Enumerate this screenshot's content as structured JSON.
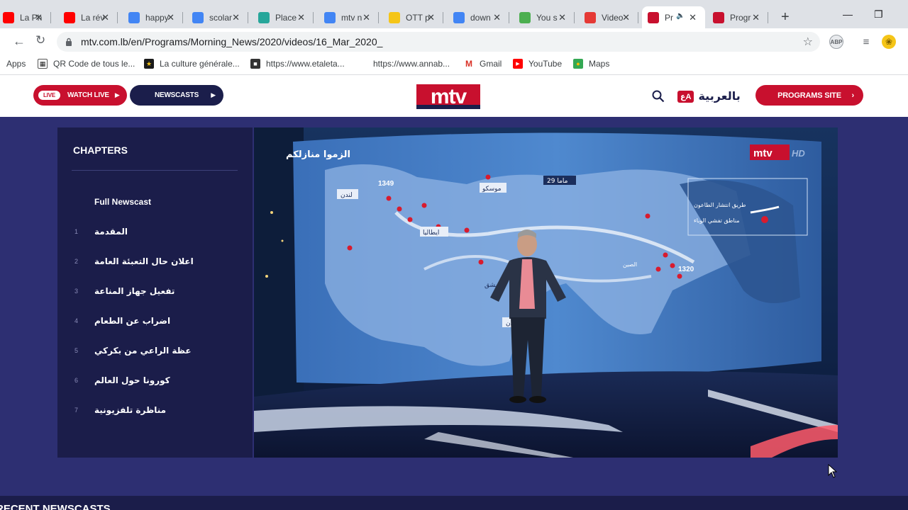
{
  "browser": {
    "tabs": [
      {
        "title": "La Ph",
        "favicon": "youtube-icon",
        "color": "#ff0000"
      },
      {
        "title": "La rév",
        "favicon": "youtube-icon",
        "color": "#ff0000"
      },
      {
        "title": "happy",
        "favicon": "google-icon",
        "color": "#4285f4"
      },
      {
        "title": "scolar",
        "favicon": "google-icon",
        "color": "#4285f4"
      },
      {
        "title": "Place",
        "favicon": "globe-icon",
        "color": "#26a69a"
      },
      {
        "title": "mtv n",
        "favicon": "google-icon",
        "color": "#4285f4"
      },
      {
        "title": "OTT p",
        "favicon": "ott-icon",
        "color": "#f5c518"
      },
      {
        "title": "down",
        "favicon": "google-icon",
        "color": "#4285f4"
      },
      {
        "title": "You s",
        "favicon": "grid-icon",
        "color": "#4caf50"
      },
      {
        "title": "Video",
        "favicon": "cloud-icon",
        "color": "#e53935"
      },
      {
        "title": "Pr",
        "favicon": "mtv-icon",
        "color": "#c8102e",
        "active": true
      },
      {
        "title": "Progr",
        "favicon": "mtv-icon",
        "color": "#c8102e"
      }
    ],
    "address": "mtv.com.lb/en/Programs/Morning_News/2020/videos/16_Mar_2020_",
    "bookmarks": [
      {
        "label": "Apps",
        "icon": "apps-grid-icon"
      },
      {
        "label": "QR Code de tous le...",
        "icon": "qr-icon"
      },
      {
        "label": "La culture générale...",
        "icon": "star-badge-icon"
      },
      {
        "label": "https://www.etaleta...",
        "icon": "site-icon"
      },
      {
        "label": "https://www.annab...",
        "icon": "blank-page-icon"
      },
      {
        "label": "Gmail",
        "icon": "gmail-icon"
      },
      {
        "label": "YouTube",
        "icon": "youtube-icon"
      },
      {
        "label": "Maps",
        "icon": "maps-icon"
      }
    ]
  },
  "site": {
    "live_badge": "LIVE",
    "watch_live": "WATCH LIVE",
    "newscasts": "NEWSCASTS",
    "logo": "mtv",
    "arabic_label": "بالعربية",
    "arabic_tag": "عA",
    "programs_site": "PROGRAMS SITE",
    "colors": {
      "red": "#c8102e",
      "navy": "#1b1e4b"
    }
  },
  "chapters": {
    "heading": "CHAPTERS",
    "items": [
      {
        "num": "",
        "label": "Full Newscast"
      },
      {
        "num": "1",
        "label": "المقدمة"
      },
      {
        "num": "2",
        "label": "اعلان حال التعبئة العامة"
      },
      {
        "num": "3",
        "label": "تفعيل جهاز المناعة"
      },
      {
        "num": "4",
        "label": "اضراب عن الطعام"
      },
      {
        "num": "5",
        "label": "عظة الراعي من بكركي"
      },
      {
        "num": "6",
        "label": "كورونا حول العالم"
      },
      {
        "num": "7",
        "label": "مناظرة تلفزيونية"
      }
    ]
  },
  "video": {
    "overlay_title": "الزموا منازلكم",
    "watermark": "mtv",
    "watermark_hd": "HD",
    "map_labels": {
      "year_1349": "1349",
      "year_1320": "1320",
      "london": "لندن",
      "moscow": "موسكو",
      "italy": "ايطاليا",
      "damascus": "دمشق",
      "aden": "عدن",
      "china": "الصين",
      "sumatra_days": "29 ماما"
    },
    "legend": {
      "line1": "طريق انتشار الطاعون",
      "line2": "مناطق تفشي الوباء"
    }
  },
  "footer": {
    "recent_heading": "RECENT NEWSCASTS"
  }
}
